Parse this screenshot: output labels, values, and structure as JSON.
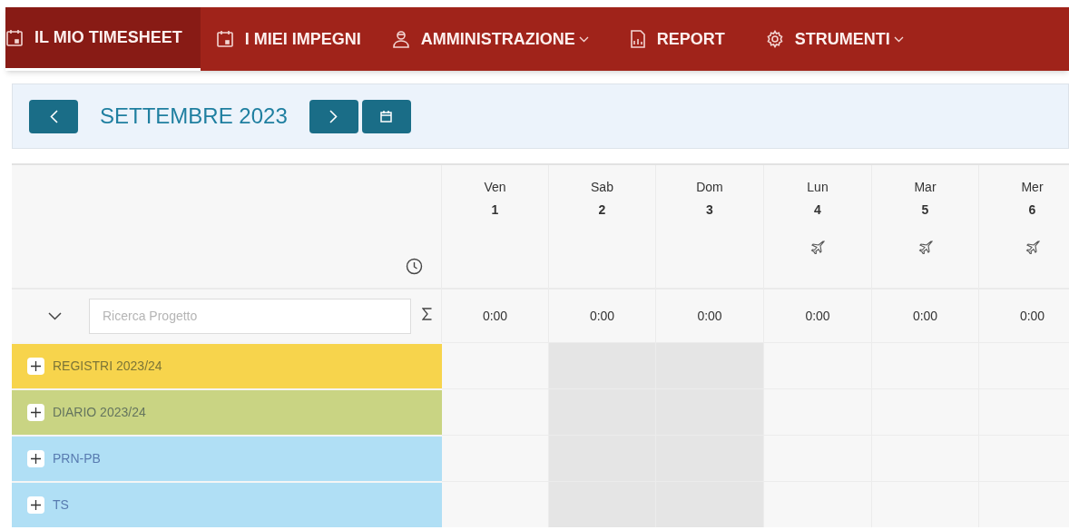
{
  "nav": {
    "tabs": [
      {
        "label": "IL MIO TIMESHEET",
        "selected": true,
        "dropdown": false
      },
      {
        "label": "I MIEI IMPEGNI",
        "selected": false,
        "dropdown": false
      },
      {
        "label": "AMMINISTRAZIONE",
        "selected": false,
        "dropdown": true
      },
      {
        "label": "REPORT",
        "selected": false,
        "dropdown": false
      },
      {
        "label": "STRUMENTI",
        "selected": false,
        "dropdown": true
      }
    ]
  },
  "month": {
    "title": "SETTEMBRE 2023"
  },
  "search": {
    "placeholder": "Ricerca Progetto"
  },
  "days": [
    {
      "weekday": "Ven",
      "day": "1",
      "weekend": false,
      "holiday": false,
      "total": "0:00"
    },
    {
      "weekday": "Sab",
      "day": "2",
      "weekend": true,
      "holiday": false,
      "total": "0:00"
    },
    {
      "weekday": "Dom",
      "day": "3",
      "weekend": true,
      "holiday": false,
      "total": "0:00"
    },
    {
      "weekday": "Lun",
      "day": "4",
      "weekend": false,
      "holiday": true,
      "total": "0:00"
    },
    {
      "weekday": "Mar",
      "day": "5",
      "weekend": false,
      "holiday": true,
      "total": "0:00"
    },
    {
      "weekday": "Mer",
      "day": "6",
      "weekend": false,
      "holiday": true,
      "total": "0:00"
    }
  ],
  "projects": [
    {
      "name": "REGISTRI 2023/24",
      "color": "#f7d44c"
    },
    {
      "name": "DIARIO 2023/24",
      "color": "#c9d483"
    },
    {
      "name": "PRN-PB",
      "color": "#b0dff5"
    },
    {
      "name": "TS",
      "color": "#b0dff5"
    }
  ]
}
